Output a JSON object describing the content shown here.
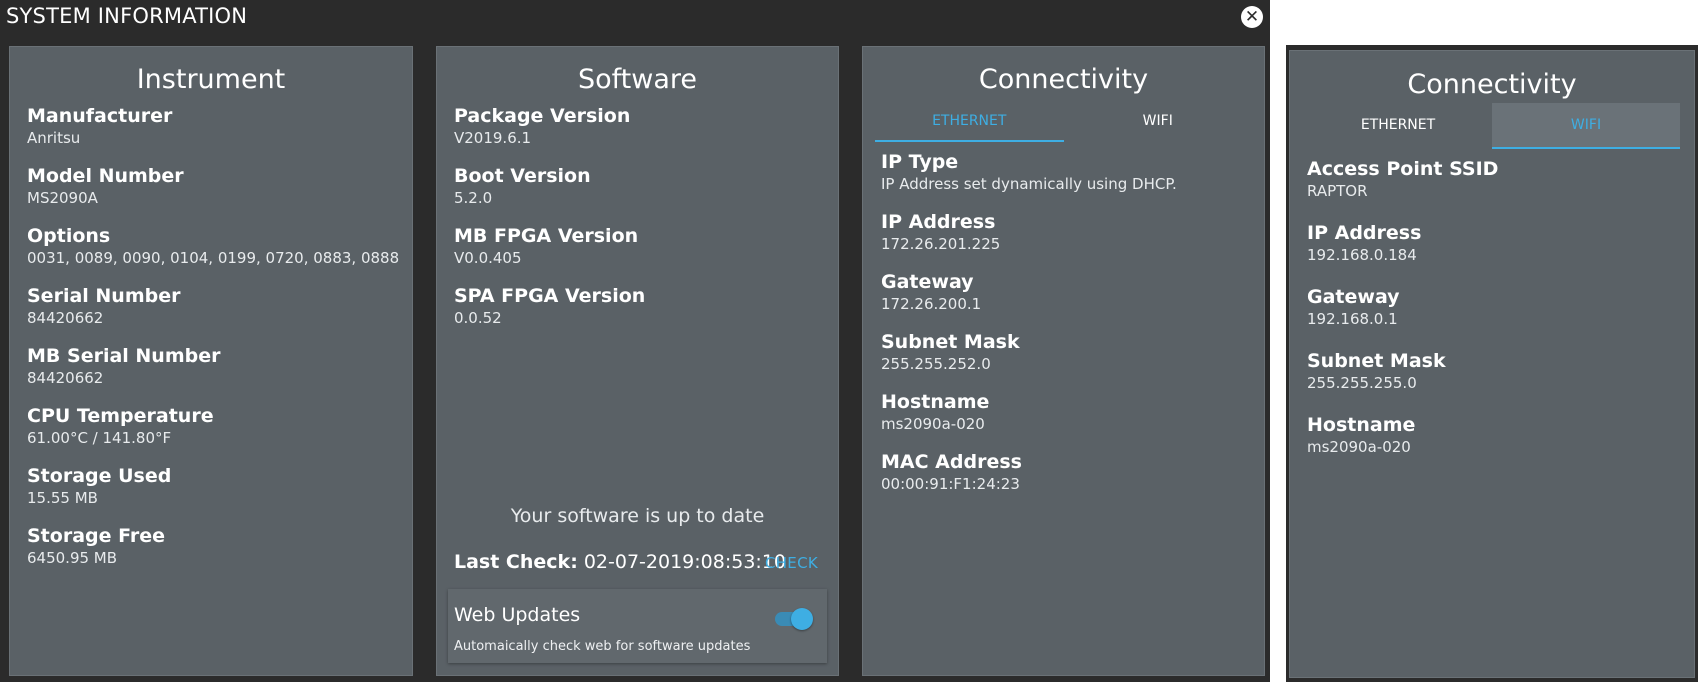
{
  "dialog": {
    "title": "SYSTEM INFORMATION",
    "close_icon": "close-icon"
  },
  "instrument": {
    "title": "Instrument",
    "fields": [
      {
        "label": "Manufacturer",
        "value": "Anritsu"
      },
      {
        "label": "Model Number",
        "value": "MS2090A"
      },
      {
        "label": "Options",
        "value": "0031, 0089, 0090, 0104, 0199, 0720, 0883, 0888"
      },
      {
        "label": "Serial Number",
        "value": "84420662"
      },
      {
        "label": "MB Serial Number",
        "value": "84420662"
      },
      {
        "label": "CPU Temperature",
        "value": "61.00°C / 141.80°F"
      },
      {
        "label": "Storage Used",
        "value": "15.55 MB"
      },
      {
        "label": "Storage Free",
        "value": "6450.95 MB"
      }
    ]
  },
  "software": {
    "title": "Software",
    "fields": [
      {
        "label": "Package Version",
        "value": "V2019.6.1"
      },
      {
        "label": "Boot Version",
        "value": "5.2.0"
      },
      {
        "label": "MB FPGA Version",
        "value": "V0.0.405"
      },
      {
        "label": "SPA FPGA Version",
        "value": "0.0.52"
      }
    ],
    "status": "Your software is up to date",
    "last_check_label": "Last Check:",
    "last_check_value": "02-07-2019:08:53:10",
    "check_button": "CHECK",
    "web_updates": {
      "title": "Web Updates",
      "description": "Automaically check web for software updates",
      "enabled": true
    }
  },
  "connectivity_ethernet": {
    "title": "Connectivity",
    "tabs": [
      "ETHERNET",
      "WIFI"
    ],
    "active_tab": "ETHERNET",
    "fields": [
      {
        "label": "IP Type",
        "value": "IP Address set dynamically using DHCP."
      },
      {
        "label": "IP Address",
        "value": "172.26.201.225"
      },
      {
        "label": "Gateway",
        "value": "172.26.200.1"
      },
      {
        "label": "Subnet Mask",
        "value": "255.255.252.0"
      },
      {
        "label": "Hostname",
        "value": "ms2090a-020"
      },
      {
        "label": "MAC Address",
        "value": "00:00:91:F1:24:23"
      }
    ]
  },
  "connectivity_wifi": {
    "title": "Connectivity",
    "tabs": [
      "ETHERNET",
      "WIFI"
    ],
    "active_tab": "WIFI",
    "fields": [
      {
        "label": "Access Point SSID",
        "value": "RAPTOR"
      },
      {
        "label": "IP Address",
        "value": "192.168.0.184"
      },
      {
        "label": "Gateway",
        "value": "192.168.0.1"
      },
      {
        "label": "Subnet Mask",
        "value": "255.255.255.0"
      },
      {
        "label": "Hostname",
        "value": "ms2090a-020"
      }
    ]
  },
  "colors": {
    "accent": "#3eaee3",
    "panel": "#5a6166",
    "background": "#2b2b2b"
  }
}
